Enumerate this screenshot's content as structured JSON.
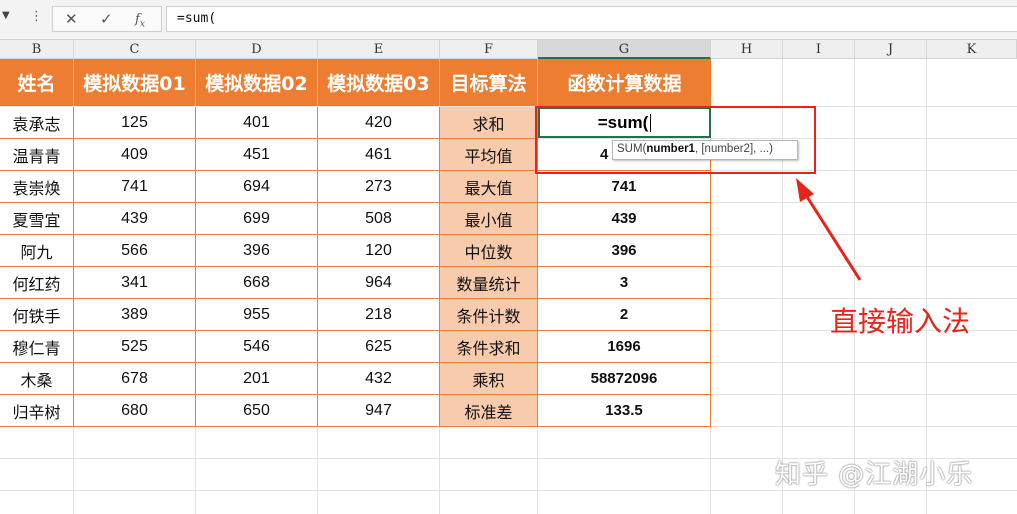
{
  "formula_bar": {
    "formula": "=sum("
  },
  "column_headers": [
    "B",
    "C",
    "D",
    "E",
    "F",
    "G",
    "H",
    "I",
    "J",
    "K"
  ],
  "table": {
    "headers": [
      "姓名",
      "模拟数据01",
      "模拟数据02",
      "模拟数据03",
      "目标算法",
      "函数计算数据"
    ],
    "rows": [
      {
        "name": "袁承志",
        "d1": "125",
        "d2": "401",
        "d3": "420",
        "method": "求和",
        "result": "=sum("
      },
      {
        "name": "温青青",
        "d1": "409",
        "d2": "451",
        "d3": "461",
        "method": "平均值",
        "result": "4"
      },
      {
        "name": "袁崇焕",
        "d1": "741",
        "d2": "694",
        "d3": "273",
        "method": "最大值",
        "result": "741"
      },
      {
        "name": "夏雪宜",
        "d1": "439",
        "d2": "699",
        "d3": "508",
        "method": "最小值",
        "result": "439"
      },
      {
        "name": "阿九",
        "d1": "566",
        "d2": "396",
        "d3": "120",
        "method": "中位数",
        "result": "396"
      },
      {
        "name": "何红药",
        "d1": "341",
        "d2": "668",
        "d3": "964",
        "method": "数量统计",
        "result": "3"
      },
      {
        "name": "何铁手",
        "d1": "389",
        "d2": "955",
        "d3": "218",
        "method": "条件计数",
        "result": "2"
      },
      {
        "name": "穆仁青",
        "d1": "525",
        "d2": "546",
        "d3": "625",
        "method": "条件求和",
        "result": "1696"
      },
      {
        "name": "木桑",
        "d1": "678",
        "d2": "201",
        "d3": "432",
        "method": "乘积",
        "result": "58872096"
      },
      {
        "name": "归辛树",
        "d1": "680",
        "d2": "650",
        "d3": "947",
        "method": "标准差",
        "result": "133.5"
      }
    ]
  },
  "tooltip": {
    "prefix": "SUM(",
    "arg1": "number1",
    "rest": ", [number2], ...)"
  },
  "annotation": "直接输入法",
  "watermark": "知乎 @江湖小乐",
  "colors": {
    "header": "#ed7d31",
    "method_fill": "#f8cbad",
    "annotation": "#e8241a",
    "active_border": "#217346"
  }
}
